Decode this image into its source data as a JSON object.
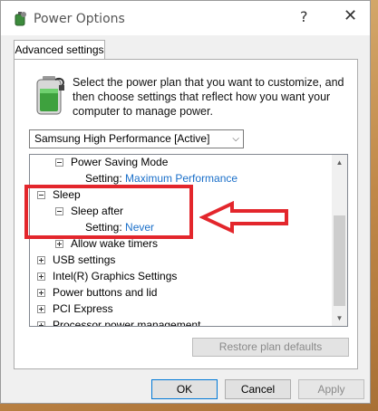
{
  "window": {
    "title": "Power Options",
    "help_glyph": "?",
    "close_glyph": "✕"
  },
  "tab": {
    "label": "Advanced settings"
  },
  "description": "Select the power plan that you want to customize, and then choose settings that reflect how you want your computer to manage power.",
  "plan_select": {
    "value": "Samsung High Performance [Active]"
  },
  "tree": {
    "power_saving_mode": "Power Saving Mode",
    "power_saving_setting_label": "Setting:",
    "power_saving_setting_value": "Maximum Performance",
    "sleep": "Sleep",
    "sleep_after": "Sleep after",
    "sleep_after_setting_label": "Setting:",
    "sleep_after_setting_value": "Never",
    "allow_wake_timers": "Allow wake timers",
    "usb_settings": "USB settings",
    "intel_graphics": "Intel(R) Graphics Settings",
    "power_buttons": "Power buttons and lid",
    "pci_express": "PCI Express",
    "processor_power": "Processor power management"
  },
  "buttons": {
    "restore": "Restore plan defaults",
    "ok": "OK",
    "cancel": "Cancel",
    "apply": "Apply"
  },
  "colors": {
    "link": "#1a6fc9",
    "annotation": "#e3262c"
  }
}
